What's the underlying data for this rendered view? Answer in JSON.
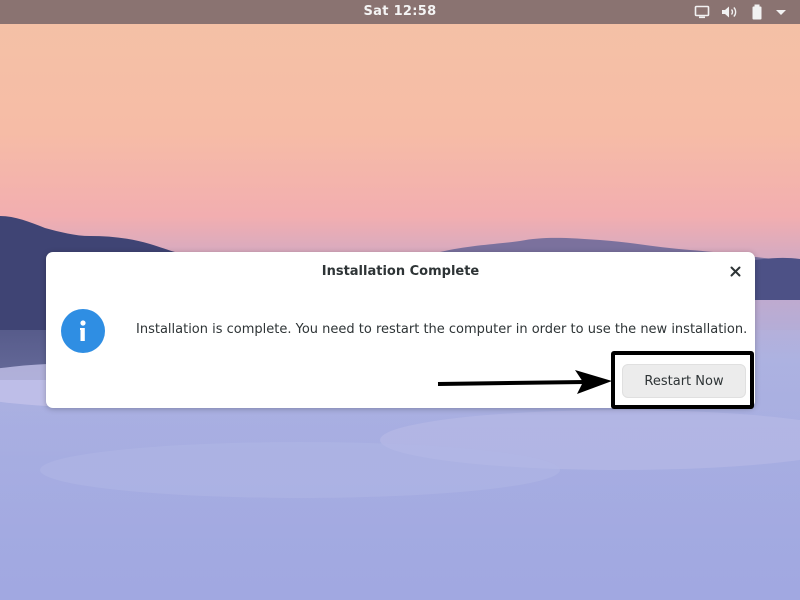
{
  "topbar": {
    "clock": "Sat 12:58",
    "icons": [
      "display-icon",
      "volume-icon",
      "battery-icon",
      "system-menu-arrow-icon"
    ]
  },
  "dialog": {
    "title": "Installation Complete",
    "message": "Installation is complete. You need to restart the computer in order to use the new installation.",
    "button_label": "Restart Now",
    "icon": "info-icon",
    "close_icon": "close-icon"
  },
  "annotation": {
    "type": "arrow-and-box",
    "target": "Restart Now"
  },
  "colors": {
    "topbar": "#806c6c",
    "info_icon": "#2f8ee3",
    "button_bg": "#ececec",
    "annotation": "#000000",
    "sky_top": "#f5bfa6",
    "sky_mid": "#f6b5a8",
    "fog": "#a9b1e3"
  }
}
